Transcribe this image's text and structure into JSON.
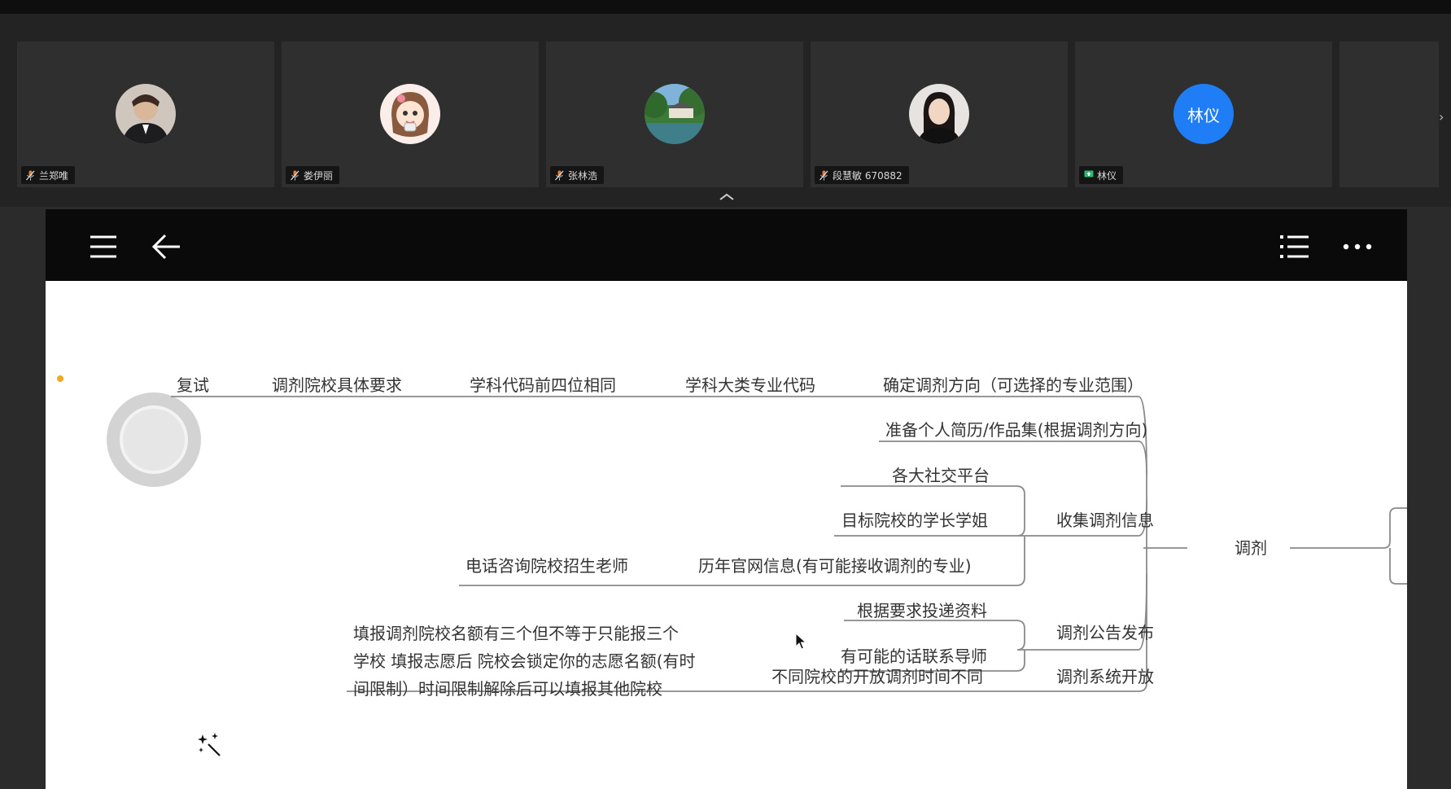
{
  "participants": [
    {
      "name": "兰郑唯",
      "avatar": "avatar-photo-suit",
      "mic_muted": true
    },
    {
      "name": "娄伊丽",
      "avatar": "avatar-cartoon-girl",
      "mic_muted": true
    },
    {
      "name": "张林浩",
      "avatar": "avatar-landscape",
      "mic_muted": true
    },
    {
      "name": "段慧敏 670882",
      "avatar": "avatar-photo-woman",
      "mic_muted": true
    },
    {
      "name": "林仪",
      "avatar_text": "林仪",
      "sharing": true
    }
  ],
  "toolbar": {
    "left_icons": [
      "menu-icon",
      "back-arrow-icon"
    ],
    "right_icons": [
      "outline-list-icon",
      "more-icon"
    ]
  },
  "mindmap": {
    "root": "调剂",
    "top_branch": [
      "复试",
      "调剂院校具体要求",
      "学科代码前四位相同",
      "学科大类专业代码",
      "确定调剂方向（可选择的专业范围）"
    ],
    "resume": "准备个人简历/作品集(根据调剂方向)",
    "collect": {
      "label": "收集调剂信息",
      "children": [
        "各大社交平台",
        "目标院校的学长学姐",
        "历年官网信息(有可能接收调剂的专业)"
      ],
      "phone": "电话咨询院校招生老师"
    },
    "announce": {
      "label": "调剂公告发布",
      "children": [
        "根据要求投递资料",
        "有可能的话联系导师"
      ]
    },
    "system": {
      "label": "调剂系统开放",
      "child": "不同院校的开放调剂时间不同",
      "note_lines": [
        "填报调剂院校名额有三个但不等于只能报三个",
        "学校 填报志愿后 院校会锁定你的志愿名额(有时",
        "间限制）时间限制解除后可以填报其他院校"
      ]
    }
  },
  "colors": {
    "accent_dot": "#f5a623",
    "avatar_blue": "#1f7ef5",
    "line": "#8a8a8a"
  }
}
